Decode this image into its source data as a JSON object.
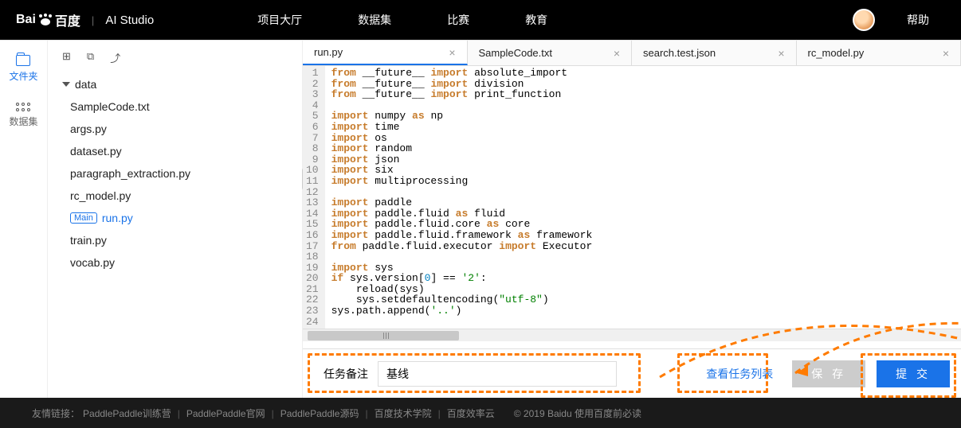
{
  "header": {
    "logo_text": "百度",
    "studio_text": "AI Studio",
    "nav": [
      "项目大厅",
      "数据集",
      "比赛",
      "教育"
    ],
    "help": "帮助"
  },
  "leftbar": {
    "files": "文件夹",
    "datasets": "数据集"
  },
  "filetree": {
    "folder": "data",
    "files": [
      "SampleCode.txt",
      "args.py",
      "dataset.py",
      "paragraph_extraction.py",
      "rc_model.py"
    ],
    "main_tag": "Main",
    "main_file": "run.py",
    "files_after": [
      "train.py",
      "vocab.py"
    ]
  },
  "tabs": [
    {
      "name": "run.py",
      "active": true
    },
    {
      "name": "SampleCode.txt",
      "active": false
    },
    {
      "name": "search.test.json",
      "active": false
    },
    {
      "name": "rc_model.py",
      "active": false
    }
  ],
  "code": {
    "lines": [
      {
        "n": 1,
        "t": [
          [
            "kw",
            "from"
          ],
          [
            "ident",
            " __future__ "
          ],
          [
            "kw",
            "import"
          ],
          [
            "ident",
            " absolute_import"
          ]
        ]
      },
      {
        "n": 2,
        "t": [
          [
            "kw",
            "from"
          ],
          [
            "ident",
            " __future__ "
          ],
          [
            "kw",
            "import"
          ],
          [
            "ident",
            " division"
          ]
        ]
      },
      {
        "n": 3,
        "t": [
          [
            "kw",
            "from"
          ],
          [
            "ident",
            " __future__ "
          ],
          [
            "kw",
            "import"
          ],
          [
            "ident",
            " print_function"
          ]
        ]
      },
      {
        "n": 4,
        "t": []
      },
      {
        "n": 5,
        "t": [
          [
            "kw",
            "import"
          ],
          [
            "ident",
            " numpy "
          ],
          [
            "kw",
            "as"
          ],
          [
            "ident",
            " np"
          ]
        ]
      },
      {
        "n": 6,
        "t": [
          [
            "kw",
            "import"
          ],
          [
            "ident",
            " time"
          ]
        ]
      },
      {
        "n": 7,
        "t": [
          [
            "kw",
            "import"
          ],
          [
            "ident",
            " os"
          ]
        ]
      },
      {
        "n": 8,
        "t": [
          [
            "kw",
            "import"
          ],
          [
            "ident",
            " random"
          ]
        ]
      },
      {
        "n": 9,
        "t": [
          [
            "kw",
            "import"
          ],
          [
            "ident",
            " json"
          ]
        ]
      },
      {
        "n": 10,
        "t": [
          [
            "kw",
            "import"
          ],
          [
            "ident",
            " six"
          ]
        ]
      },
      {
        "n": 11,
        "t": [
          [
            "kw",
            "import"
          ],
          [
            "ident",
            " multiprocessing"
          ]
        ]
      },
      {
        "n": 12,
        "t": []
      },
      {
        "n": 13,
        "t": [
          [
            "kw",
            "import"
          ],
          [
            "ident",
            " paddle"
          ]
        ]
      },
      {
        "n": 14,
        "t": [
          [
            "kw",
            "import"
          ],
          [
            "ident",
            " paddle.fluid "
          ],
          [
            "kw",
            "as"
          ],
          [
            "ident",
            " fluid"
          ]
        ]
      },
      {
        "n": 15,
        "t": [
          [
            "kw",
            "import"
          ],
          [
            "ident",
            " paddle.fluid.core "
          ],
          [
            "kw",
            "as"
          ],
          [
            "ident",
            " core"
          ]
        ]
      },
      {
        "n": 16,
        "t": [
          [
            "kw",
            "import"
          ],
          [
            "ident",
            " paddle.fluid.framework "
          ],
          [
            "kw",
            "as"
          ],
          [
            "ident",
            " framework"
          ]
        ]
      },
      {
        "n": 17,
        "t": [
          [
            "kw",
            "from"
          ],
          [
            "ident",
            " paddle.fluid.executor "
          ],
          [
            "kw",
            "import"
          ],
          [
            "ident",
            " Executor"
          ]
        ]
      },
      {
        "n": 18,
        "t": []
      },
      {
        "n": 19,
        "t": [
          [
            "kw",
            "import"
          ],
          [
            "ident",
            " sys"
          ]
        ]
      },
      {
        "n": 20,
        "t": [
          [
            "kw",
            "if"
          ],
          [
            "ident",
            " sys.version["
          ],
          [
            "num",
            "0"
          ],
          [
            "ident",
            "] == "
          ],
          [
            "str",
            "'2'"
          ],
          [
            "ident",
            ":"
          ]
        ]
      },
      {
        "n": 21,
        "t": [
          [
            "ident",
            "    reload(sys)"
          ]
        ]
      },
      {
        "n": 22,
        "t": [
          [
            "ident",
            "    sys.setdefaultencoding("
          ],
          [
            "str",
            "\"utf-8\""
          ],
          [
            "ident",
            ")"
          ]
        ]
      },
      {
        "n": 23,
        "t": [
          [
            "ident",
            "sys.path.append("
          ],
          [
            "str",
            "'..'"
          ],
          [
            "ident",
            ")"
          ]
        ]
      },
      {
        "n": 24,
        "t": []
      }
    ]
  },
  "bottom": {
    "task_label": "任务备注",
    "task_value": "基线",
    "view_list": "查看任务列表",
    "save": "保 存",
    "submit": "提 交"
  },
  "footer": {
    "label": "友情链接：",
    "links": [
      "PaddlePaddle训练营",
      "PaddlePaddle官网",
      "PaddlePaddle源码",
      "百度技术学院",
      "百度效率云"
    ],
    "copyright": "© 2019 Baidu 使用百度前必读"
  }
}
